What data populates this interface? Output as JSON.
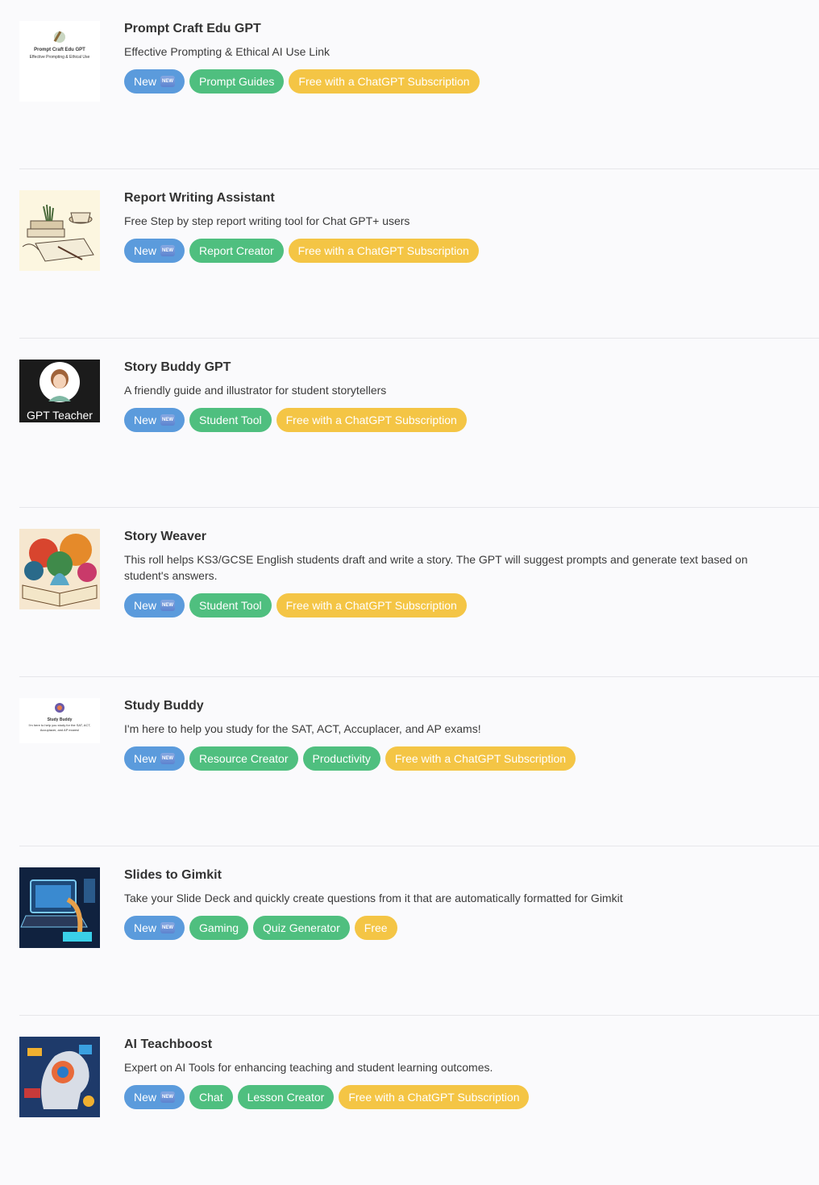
{
  "items": [
    {
      "title": "Prompt Craft Edu GPT",
      "description": "Effective Prompting & Ethical AI Use Link",
      "thumb_title": "Prompt Craft Edu GPT",
      "thumb_subtitle": "Effective Prompting & Ethical Use",
      "tags": [
        {
          "label": "New",
          "kind": "new"
        },
        {
          "label": "Prompt Guides",
          "kind": "green"
        },
        {
          "label": "Free with a ChatGPT Subscription",
          "kind": "yellow"
        }
      ]
    },
    {
      "title": "Report Writing Assistant",
      "description": "Free Step by step report writing tool for Chat GPT+ users",
      "tags": [
        {
          "label": "New",
          "kind": "new"
        },
        {
          "label": "Report Creator",
          "kind": "green"
        },
        {
          "label": "Free with a ChatGPT Subscription",
          "kind": "yellow"
        }
      ]
    },
    {
      "title": "Story Buddy GPT",
      "description": "A friendly guide and illustrator for student storytellers",
      "thumb_caption": "GPT Teacher",
      "tags": [
        {
          "label": "New",
          "kind": "new"
        },
        {
          "label": "Student Tool",
          "kind": "green"
        },
        {
          "label": "Free with a ChatGPT Subscription",
          "kind": "yellow"
        }
      ]
    },
    {
      "title": "Story Weaver",
      "description": "This roll helps KS3/GCSE English students draft and write a story. The GPT will suggest prompts and generate text based on student's answers.",
      "tags": [
        {
          "label": "New",
          "kind": "new"
        },
        {
          "label": "Student Tool",
          "kind": "green"
        },
        {
          "label": "Free with a ChatGPT Subscription",
          "kind": "yellow"
        }
      ]
    },
    {
      "title": "Study Buddy",
      "description": "I'm here to help you study for the SAT, ACT, Accuplacer, and AP exams!",
      "thumb_title": "Study Buddy",
      "thumb_subtitle": "I'm here to help you study for the SAT, ACT, Accuplacer, and AP exams!",
      "tags": [
        {
          "label": "New",
          "kind": "new"
        },
        {
          "label": "Resource Creator",
          "kind": "green"
        },
        {
          "label": "Productivity",
          "kind": "green"
        },
        {
          "label": "Free with a ChatGPT Subscription",
          "kind": "yellow"
        }
      ]
    },
    {
      "title": "Slides to Gimkit",
      "description": "Take your Slide Deck and quickly create questions from it that are automatically formatted for Gimkit",
      "tags": [
        {
          "label": "New",
          "kind": "new"
        },
        {
          "label": "Gaming",
          "kind": "green"
        },
        {
          "label": "Quiz Generator",
          "kind": "green"
        },
        {
          "label": "Free",
          "kind": "yellow"
        }
      ]
    },
    {
      "title": "AI Teachboost",
      "description": "Expert on AI Tools for enhancing teaching and student learning outcomes.",
      "tags": [
        {
          "label": "New",
          "kind": "new"
        },
        {
          "label": "Chat",
          "kind": "green"
        },
        {
          "label": "Lesson Creator",
          "kind": "green"
        },
        {
          "label": "Free with a ChatGPT Subscription",
          "kind": "yellow"
        }
      ]
    }
  ],
  "new_emoji_text": "NEW"
}
